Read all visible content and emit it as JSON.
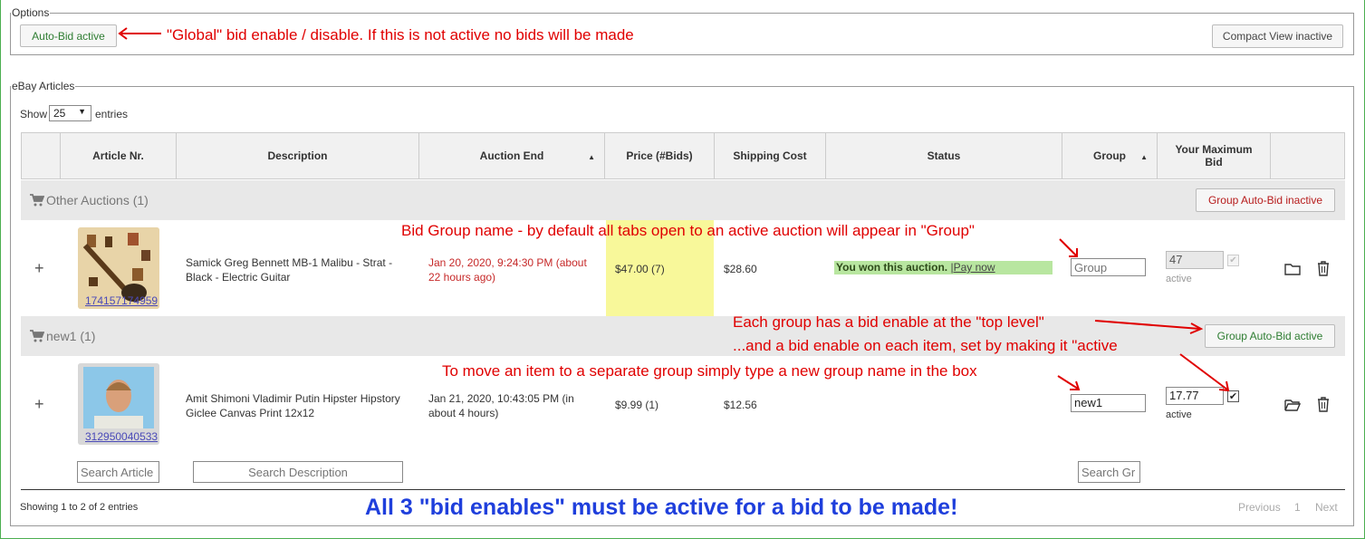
{
  "options": {
    "legend": "Options",
    "autobid_button": "Auto-Bid active",
    "compact_button": "Compact View inactive",
    "annotation": "\"Global\" bid enable / disable. If this is not active no bids will be made"
  },
  "articles": {
    "legend": "eBay Articles",
    "show_label": "Show",
    "show_value": "25",
    "entries_label": "entries",
    "columns": [
      "Article Nr.",
      "Description",
      "Auction End",
      "Price (#Bids)",
      "Shipping Cost",
      "Status",
      "Group",
      "Your Maximum Bid"
    ],
    "groups": [
      {
        "title": "Other Auctions (1)",
        "button": "Group Auto-Bid inactive",
        "item": {
          "expand": "+",
          "article_nr": "174157174959",
          "description": "Samick Greg Bennett MB-1 Malibu - Strat - Black - Electric Guitar",
          "auction_end": "Jan 20, 2020, 9:24:30 PM (about 22 hours ago)",
          "price": "$47.00 (7)",
          "shipping": "$28.60",
          "status_text": "You won this auction.",
          "status_link": "|Pay now",
          "group_placeholder": "Group",
          "max_bid": "47",
          "active_label": "active"
        }
      },
      {
        "title": "new1 (1)",
        "button": "Group Auto-Bid active",
        "item": {
          "expand": "+",
          "article_nr": "312950040533",
          "description": "Amit Shimoni Vladimir Putin Hipster Hipstory Giclee Canvas Print 12x12",
          "auction_end": "Jan 21, 2020, 10:43:05 PM (in about 4 hours)",
          "price": "$9.99 (1)",
          "shipping": "$12.56",
          "group_value": "new1",
          "max_bid": "17.77",
          "active_label": "active"
        }
      }
    ],
    "search": {
      "article_placeholder": "Search Article",
      "description_placeholder": "Search Description",
      "group_placeholder": "Search Gr"
    },
    "footer": {
      "showing": "Showing 1 to 2 of 2 entries",
      "previous": "Previous",
      "page": "1",
      "next": "Next"
    }
  },
  "annotations": {
    "group_name": "Bid Group name - by default all tabs open to an active auction will appear in \"Group\"",
    "top_level_1": "Each group has a bid enable at the \"top level\"",
    "top_level_2": "...and a bid enable on each item, set by making it \"active",
    "move_item": "To move an item to a separate group simply type a new group name in the box",
    "all_three": "All 3 \"bid enables\" must be active for a bid to be made!"
  },
  "colors": {
    "annotation_red": "#e00000",
    "annotation_blue": "#1f3fdc",
    "status_won_bg": "#b8e6a0",
    "price_highlight": "#f8f89a"
  }
}
